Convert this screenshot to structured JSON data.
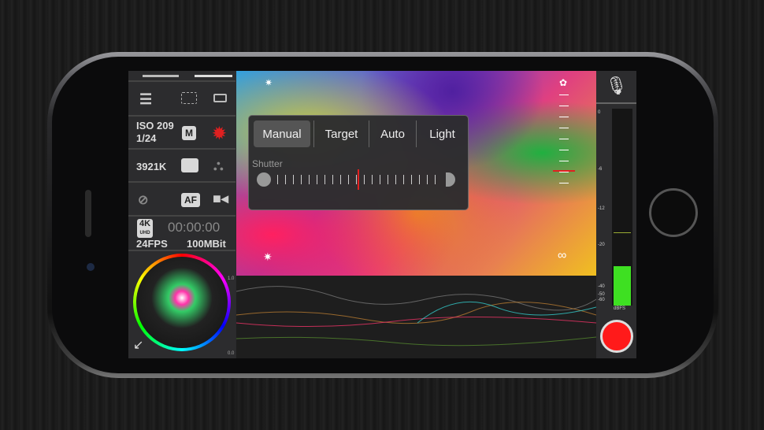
{
  "left_panel": {
    "iso": "ISO 209",
    "shutter": "1/24",
    "mode_badge": "M",
    "white_balance": "3921K",
    "focus_badge": "AF",
    "resolution_badge": "4K",
    "resolution_sub": "UHD",
    "timecode": "00:00:00",
    "fps": "24FPS",
    "bitrate": "100MBit"
  },
  "exposure_popup": {
    "tabs": [
      "Manual",
      "Target",
      "Auto",
      "Light"
    ],
    "selected": "Manual",
    "slider_label": "Shutter"
  },
  "waveform": {
    "scale_top": "1.0",
    "scale_bottom": "0.0"
  },
  "audio_meter": {
    "labels": [
      "0",
      "-6",
      "-12",
      "-20",
      "-40",
      "-50",
      "-60"
    ],
    "unit": "dBFS",
    "level_db": -30,
    "peak_db": -16
  },
  "viewfinder": {
    "infinity": "∞"
  },
  "colors": {
    "record": "#ff1a1a",
    "meter": "#3ee022",
    "accent_red": "#e02020"
  }
}
